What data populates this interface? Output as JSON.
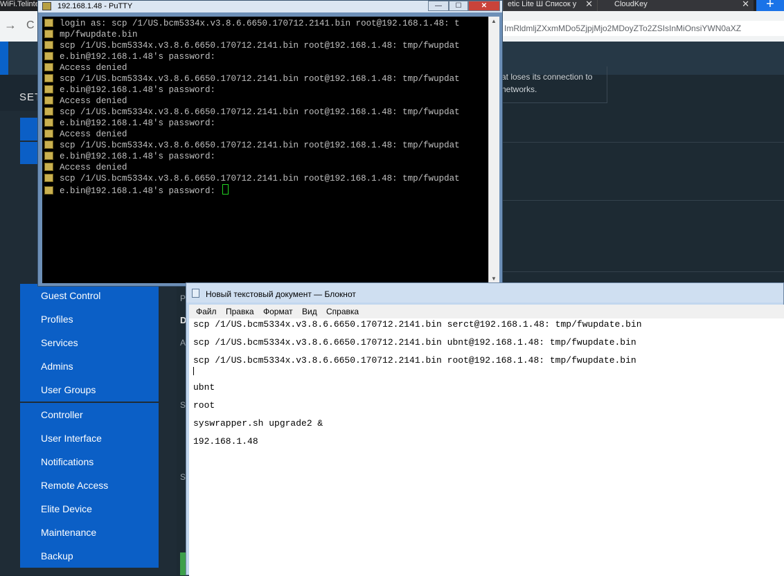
{
  "browser": {
    "left_tab_text": "WiFi.Telinte",
    "tabs": [
      {
        "label": "etic Lite Ш Список у",
        "close": "✕"
      },
      {
        "label": "CloudKey",
        "close": "✕"
      }
    ],
    "new_tab_label": "+",
    "url_fragment": "ImRldmljZXxmMDo5ZjpjMjo2MDoyZTo2ZSIsInMiOnsiYWN0aXZ"
  },
  "unifi": {
    "settings_heading": "SET",
    "card_text": [
      "at loses its connection to",
      "networks."
    ],
    "side_letters": [
      "P",
      "D",
      "A",
      "S",
      "S"
    ],
    "sidebar_group1": [
      "Guest Control",
      "Profiles",
      "Services",
      "Admins",
      "User Groups"
    ],
    "sidebar_group2": [
      "Controller",
      "User Interface",
      "Notifications",
      "Remote Access",
      "Elite Device",
      "Maintenance",
      "Backup"
    ]
  },
  "putty": {
    "title": "192.168.1.48 - PuTTY",
    "min": "—",
    "max": "☐",
    "close": "✕",
    "terminal_lines": [
      "login as: scp /1/US.bcm5334x.v3.8.6.6650.170712.2141.bin root@192.168.1.48: t",
      "mp/fwupdate.bin",
      "scp /1/US.bcm5334x.v3.8.6.6650.170712.2141.bin root@192.168.1.48: tmp/fwupdat",
      "e.bin@192.168.1.48's password:",
      "Access denied",
      "scp /1/US.bcm5334x.v3.8.6.6650.170712.2141.bin root@192.168.1.48: tmp/fwupdat",
      "e.bin@192.168.1.48's password:",
      "Access denied",
      "scp /1/US.bcm5334x.v3.8.6.6650.170712.2141.bin root@192.168.1.48: tmp/fwupdat",
      "e.bin@192.168.1.48's password:",
      "Access denied",
      "scp /1/US.bcm5334x.v3.8.6.6650.170712.2141.bin root@192.168.1.48: tmp/fwupdat",
      "e.bin@192.168.1.48's password:",
      "Access denied",
      "scp /1/US.bcm5334x.v3.8.6.6650.170712.2141.bin root@192.168.1.48: tmp/fwupdat",
      "e.bin@192.168.1.48's password: "
    ]
  },
  "notepad": {
    "title": "Новый текстовый документ — Блокнот",
    "menu": [
      "Файл",
      "Правка",
      "Формат",
      "Вид",
      "Справка"
    ],
    "lines": [
      "scp /1/US.bcm5334x.v3.8.6.6650.170712.2141.bin serct@192.168.1.48: tmp/fwupdate.bin",
      "scp /1/US.bcm5334x.v3.8.6.6650.170712.2141.bin ubnt@192.168.1.48: tmp/fwupdate.bin",
      "scp /1/US.bcm5334x.v3.8.6.6650.170712.2141.bin root@192.168.1.48: tmp/fwupdate.bin",
      "ubnt",
      "root",
      "syswrapper.sh upgrade2 &",
      "192.168.1.48"
    ]
  },
  "colors": {
    "unifi_blue": "#0b5fc6",
    "terminal_bg": "#000000",
    "terminal_fg": "#c0c0c0",
    "cursor_green": "#21d321"
  }
}
